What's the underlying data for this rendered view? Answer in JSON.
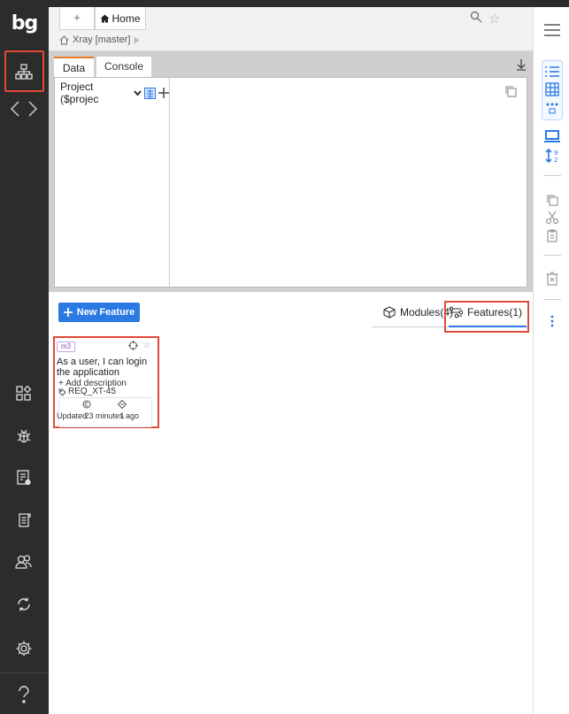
{
  "app": {
    "logo": "bg"
  },
  "tabs": {
    "new_tab": "+",
    "home_label": "Home"
  },
  "breadcrumb": {
    "label": "Xray [master]"
  },
  "panel": {
    "tab_data": "Data",
    "tab_console": "Console",
    "project_select": "Project ($projec"
  },
  "actions": {
    "new_feature": "New Feature"
  },
  "view_tabs": {
    "modules": "Modules(4)",
    "features": "Features(1)"
  },
  "feature_card": {
    "badge": "m3",
    "title": "As a user, I can login the application",
    "add_description": "+ Add description",
    "requirement": "REQ_XT-45",
    "stat_one": "2",
    "stat_two": "1",
    "updated": "Updated 3 minutes ago"
  },
  "colors": {
    "accent": "#2a7ae2",
    "highlight": "#e04a3a",
    "sidebar": "#2c2c2c",
    "tab_active": "#e87b2a"
  }
}
